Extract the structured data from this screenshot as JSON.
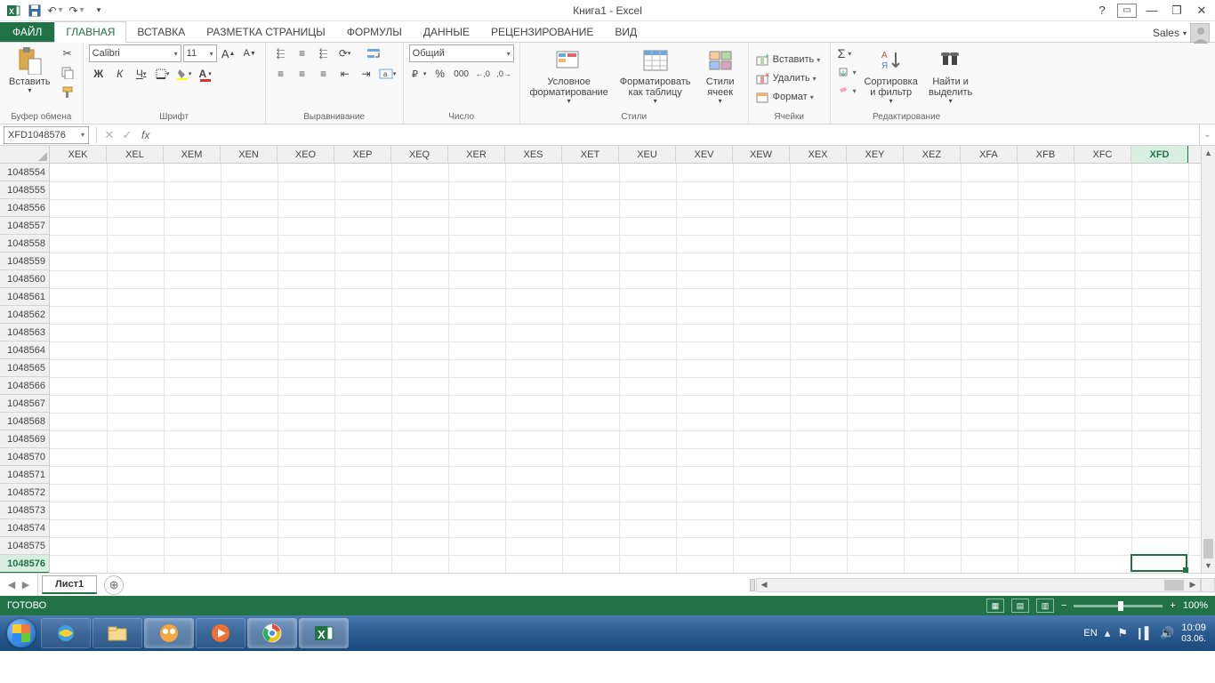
{
  "title": "Книга1 - Excel",
  "qat": {
    "undo_dd": "▾",
    "redo_dd": "▾",
    "more": "▾"
  },
  "tabs": {
    "file": "ФАЙЛ",
    "home": "ГЛАВНАЯ",
    "insert": "ВСТАВКА",
    "layout": "РАЗМЕТКА СТРАНИЦЫ",
    "formulas": "ФОРМУЛЫ",
    "data": "ДАННЫЕ",
    "review": "РЕЦЕНЗИРОВАНИЕ",
    "view": "ВИД"
  },
  "account": {
    "name": "Sales",
    "dd": "▾"
  },
  "ribbon": {
    "clipboard": {
      "paste": "Вставить",
      "label": "Буфер обмена"
    },
    "font": {
      "name": "Calibri",
      "size": "11",
      "bold": "Ж",
      "italic": "К",
      "underline": "Ч",
      "label": "Шрифт"
    },
    "align": {
      "label": "Выравнивание"
    },
    "number": {
      "format": "Общий",
      "label": "Число"
    },
    "styles": {
      "cond": "Условное форматирование",
      "table": "Форматировать как таблицу",
      "cell": "Стили ячеек",
      "label": "Стили"
    },
    "cells": {
      "insert": "Вставить",
      "delete": "Удалить",
      "format": "Формат",
      "label": "Ячейки"
    },
    "editing": {
      "sort": "Сортировка и фильтр",
      "find": "Найти и выделить",
      "label": "Редактирование"
    }
  },
  "namebox": "XFD1048576",
  "columns": [
    "XEK",
    "XEL",
    "XEM",
    "XEN",
    "XEO",
    "XEP",
    "XEQ",
    "XER",
    "XES",
    "XET",
    "XEU",
    "XEV",
    "XEW",
    "XEX",
    "XEY",
    "XEZ",
    "XFA",
    "XFB",
    "XFC",
    "XFD"
  ],
  "sel_col": "XFD",
  "row_start": 1048554,
  "row_end": 1048576,
  "sel_row": 1048576,
  "sheet": {
    "name": "Лист1"
  },
  "status": {
    "ready": "ГОТОВО",
    "zoom": "100%"
  },
  "tray": {
    "lang": "EN",
    "time": "10:09",
    "date": "03.06."
  }
}
